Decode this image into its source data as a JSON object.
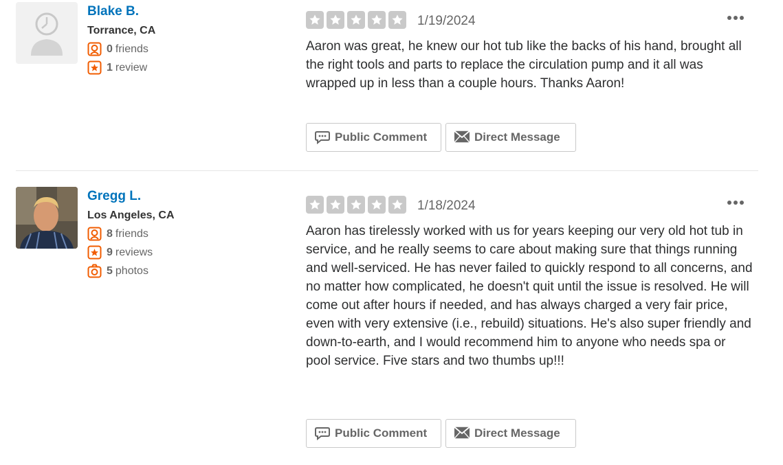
{
  "reviews": [
    {
      "user": {
        "name": "Blake B.",
        "location": "Torrance, CA",
        "friends_count": "0",
        "friends_label": "friends",
        "reviews_count": "1",
        "reviews_label": "review"
      },
      "rating": 5,
      "date": "1/19/2024",
      "text": "Aaron was great, he knew our hot tub like the backs of his hand, brought all the right tools and parts to replace the circulation pump and it all was wrapped up in less than a couple hours. Thanks Aaron!",
      "public_comment_label": "Public Comment",
      "direct_message_label": "Direct Message"
    },
    {
      "user": {
        "name": "Gregg L.",
        "location": "Los Angeles, CA",
        "friends_count": "8",
        "friends_label": "friends",
        "reviews_count": "9",
        "reviews_label": "reviews",
        "photos_count": "5",
        "photos_label": "photos"
      },
      "rating": 5,
      "date": "1/18/2024",
      "text": "Aaron has tirelessly worked with us for years keeping our very old hot tub in service, and he really seems to care about making sure that things running and well-serviced. He has never failed to quickly respond to all concerns, and no matter how complicated, he doesn't quit until the issue is resolved. He will come out after hours if needed, and has always charged a very fair price, even with very extensive (i.e., rebuild) situations. He's also super friendly and down-to-earth, and I would recommend him to anyone who needs spa or pool service. Five stars and two thumbs up!!!",
      "public_comment_label": "Public Comment",
      "direct_message_label": "Direct Message"
    }
  ],
  "colors": {
    "user_link": "#0073bb",
    "icon_accent": "#f15c00",
    "star_empty": "#c9c9c9"
  }
}
